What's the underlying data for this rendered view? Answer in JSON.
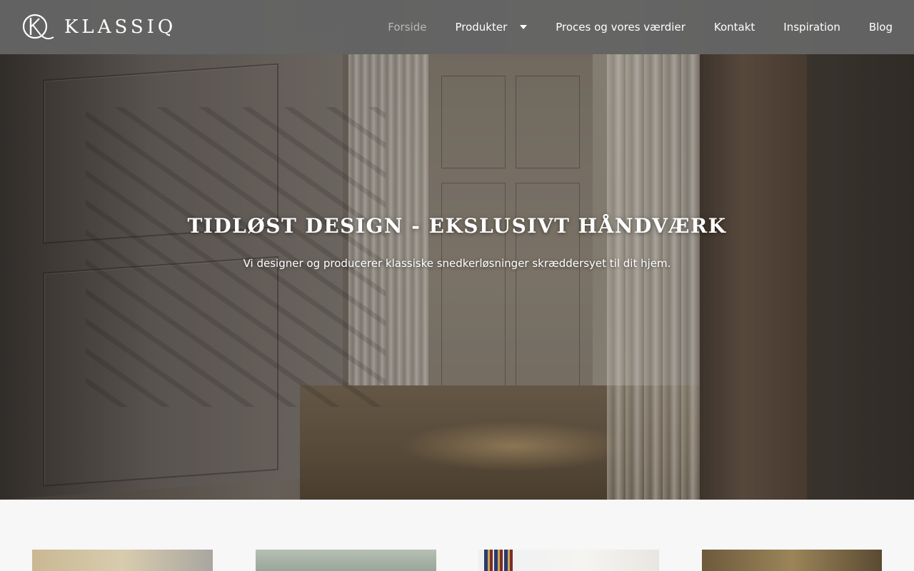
{
  "brand": {
    "name": "KLASSIQ",
    "logo_icon": "kq-monogram-icon"
  },
  "nav": {
    "items": [
      {
        "label": "Forside",
        "active": true
      },
      {
        "label": "Produkter",
        "has_dropdown": true,
        "icon": "caret-down-icon"
      },
      {
        "label": "Proces og vores værdier"
      },
      {
        "label": "Kontakt"
      },
      {
        "label": "Inspiration"
      },
      {
        "label": "Blog"
      }
    ]
  },
  "hero": {
    "title": "TIDLØST DESIGN - EKSLUSIVT HÅNDVÆRK",
    "subtitle": "Vi designer og producerer klassiske snedkerløsninger skræddersyet til dit hjem."
  },
  "colors": {
    "header_bg": "#646464",
    "nav_text": "#ffffff",
    "nav_active": "#b9b9b9",
    "page_bg": "#f7f7f7"
  }
}
